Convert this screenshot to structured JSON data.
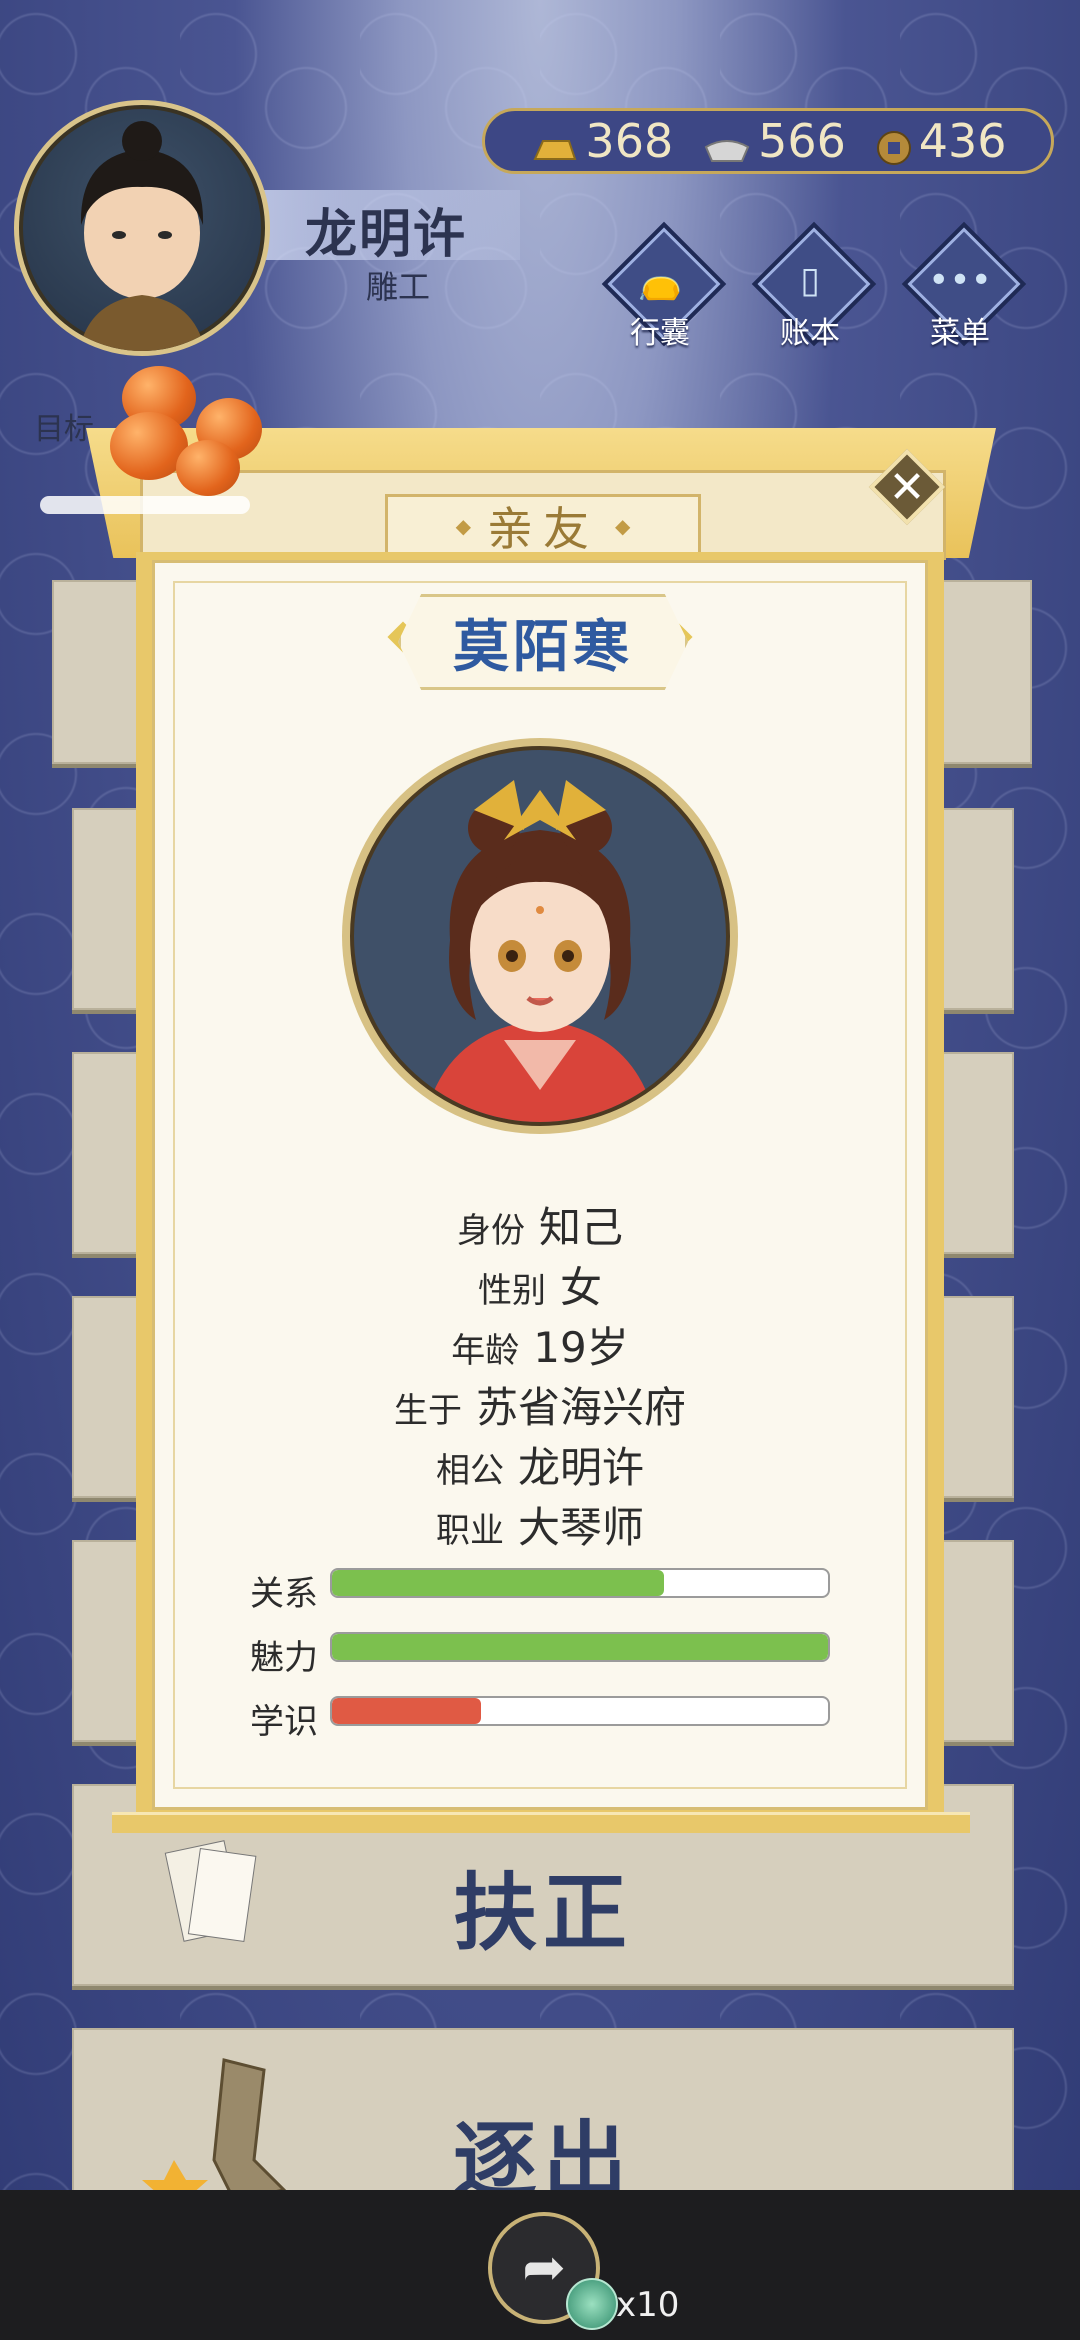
{
  "player": {
    "name": "龙明许",
    "job": "雕工"
  },
  "currency": {
    "gold": "368",
    "silver": "566",
    "coins": "436"
  },
  "menu": {
    "bag": "行囊",
    "ledger": "账本",
    "menu": "菜单"
  },
  "goal_label": "目标",
  "dialog": {
    "title": "亲友",
    "npc_name": "莫陌寒",
    "info": {
      "identity_label": "身份",
      "identity_value": "知己",
      "gender_label": "性别",
      "gender_value": "女",
      "age_label": "年龄",
      "age_value": "19岁",
      "birth_label": "生于",
      "birth_value": "苏省海兴府",
      "husband_label": "相公",
      "husband_value": "龙明许",
      "job_label": "职业",
      "job_value": "大琴师"
    },
    "stats": [
      {
        "label": "关系",
        "value": 0.67,
        "color": "#7cc04e"
      },
      {
        "label": "魅力",
        "value": 1.0,
        "color": "#7cc04e"
      },
      {
        "label": "学识",
        "value": 0.3,
        "color": "#e05a44"
      }
    ]
  },
  "actions": {
    "promote": "扶正",
    "expel": "逐出"
  },
  "share": {
    "count": "x10"
  }
}
